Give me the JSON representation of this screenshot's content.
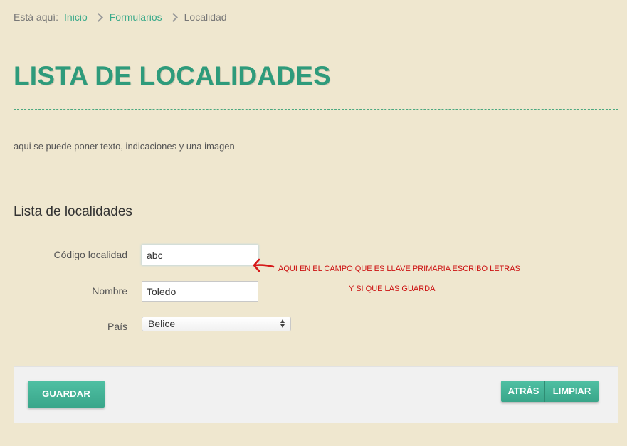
{
  "breadcrumb": {
    "prefix": "Está aquí:",
    "items": [
      "Inicio",
      "Formularios"
    ],
    "current": "Localidad"
  },
  "page": {
    "title": "LISTA DE LOCALIDADES",
    "intro": "aqui se puede poner texto, indicaciones y una imagen"
  },
  "form": {
    "section_title": "Lista de localidades",
    "codigo": {
      "label": "Código localidad",
      "value": "abc"
    },
    "nombre": {
      "label": "Nombre",
      "value": "Toledo"
    },
    "pais": {
      "label": "País",
      "selected": "Belice"
    }
  },
  "annotation": {
    "line1": "AQUI EN EL CAMPO  QUE ES LLAVE PRIMARIA ESCRIBO LETRAS",
    "line2": "Y SI QUE LAS GUARDA",
    "color": "#cc1111"
  },
  "footer": {
    "save_label": "GUARDAR",
    "back_label": "ATRÁS",
    "clear_label": "LIMPIAR"
  },
  "colors": {
    "background": "#efe7cf",
    "accent": "#2e9b7b",
    "button": "#45b496"
  }
}
